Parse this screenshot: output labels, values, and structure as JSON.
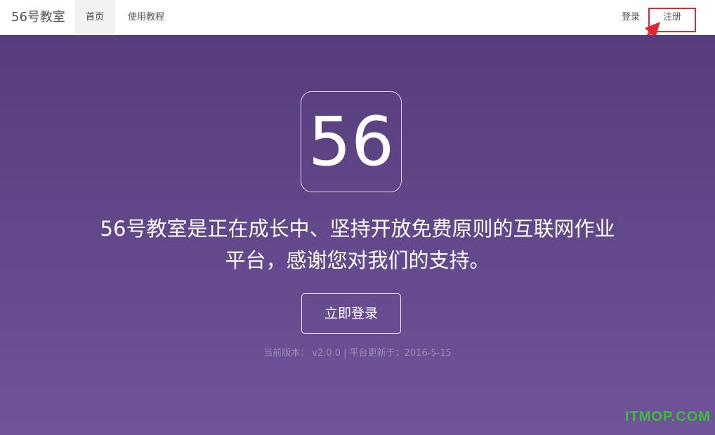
{
  "navbar": {
    "brand": "56号教室",
    "items": [
      {
        "label": "首页",
        "active": true
      },
      {
        "label": "使用教程",
        "active": false
      }
    ],
    "right": {
      "login_label": "登录",
      "register_label": "注册"
    }
  },
  "hero": {
    "logo_text": "56",
    "headline_line1": "56号教室是正在成长中、坚持开放免费原则的互联网作业",
    "headline_line2": "平台，感谢您对我们的支持。",
    "cta_label": "立即登录",
    "version_text": "当前版本： v2.0.0 | 平台更新于：2016-5-15"
  },
  "watermark": "ITMOP.COM",
  "colors": {
    "hero_top": "#563d7c",
    "hero_bottom": "#6f5499",
    "highlight": "#e0292e",
    "watermark": "#3dbb3a"
  }
}
